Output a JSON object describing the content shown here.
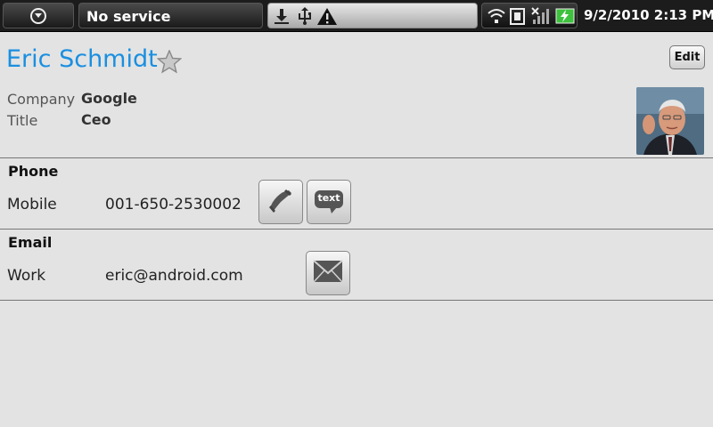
{
  "status_bar": {
    "menu_icon": "menu-circle-icon",
    "service_text": "No service",
    "notification_icons": [
      "download-icon",
      "usb-icon",
      "warning-icon"
    ],
    "system_icons": [
      "wifi-icon",
      "sim-icon",
      "no-signal-icon",
      "battery-charging-icon"
    ],
    "time": "9/2/2010 2:13 PM"
  },
  "contact": {
    "name": "Eric Schmidt",
    "star_icon": "star-icon",
    "edit_label": "Edit",
    "company_label": "Company",
    "company_value": "Google",
    "title_label": "Title",
    "title_value": "Ceo",
    "photo": "contact-photo"
  },
  "phone_section": {
    "title": "Phone",
    "type": "Mobile",
    "number": "001-650-2530002",
    "sms_label": "text"
  },
  "email_section": {
    "title": "Email",
    "type": "Work",
    "address": "eric@android.com"
  },
  "colors": {
    "name_blue": "#1a8fe0",
    "background": "#e3e3e3",
    "status_bar": "#1c1c1c"
  }
}
